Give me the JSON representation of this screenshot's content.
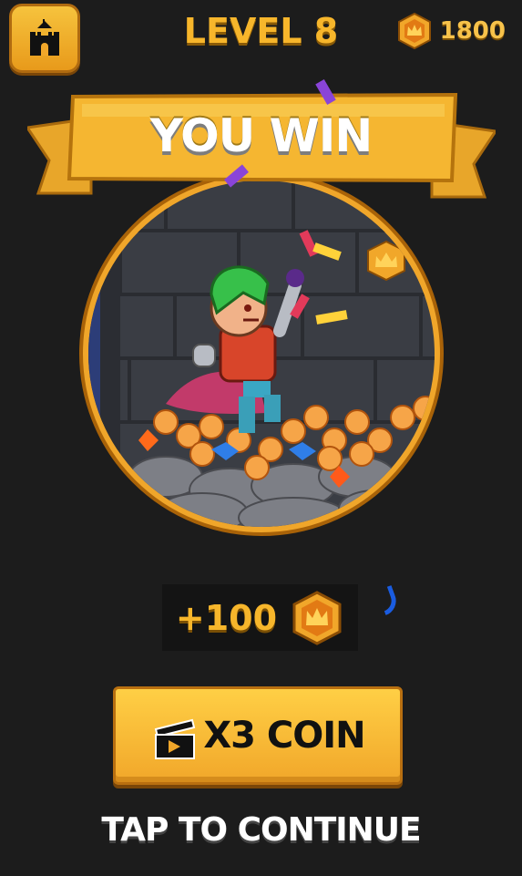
{
  "header": {
    "level_title": "LEVEL 8",
    "coin_total": "1800",
    "home_icon": "castle-icon",
    "coin_icon": "crown-coin-icon"
  },
  "banner": {
    "title": "YOU WIN"
  },
  "reward": {
    "amount": "+100",
    "coin_icon": "crown-coin-icon"
  },
  "actions": {
    "multiplier_label": "X3 COIN",
    "multiplier_icon": "clapperboard-icon",
    "continue_label": "TAP TO CONTINUE"
  },
  "colors": {
    "background": "#1c1c1c",
    "gold": "#f7b62b",
    "button": "#f1a72a",
    "frame": "#f0a62a"
  }
}
